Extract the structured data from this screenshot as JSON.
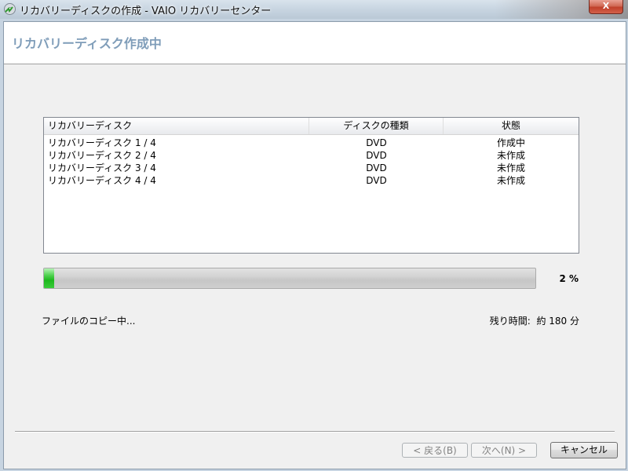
{
  "window": {
    "title": "リカバリーディスクの作成 - VAIO リカバリーセンター",
    "close_label": "X"
  },
  "header": {
    "title": "リカバリーディスク作成中"
  },
  "list": {
    "columns": [
      "リカバリーディスク",
      "ディスクの種類",
      "状態"
    ],
    "rows": [
      [
        "リカバリーディスク 1 / 4",
        "DVD",
        "作成中"
      ],
      [
        "リカバリーディスク 2 / 4",
        "DVD",
        "未作成"
      ],
      [
        "リカバリーディスク 3 / 4",
        "DVD",
        "未作成"
      ],
      [
        "リカバリーディスク 4 / 4",
        "DVD",
        "未作成"
      ]
    ]
  },
  "progress": {
    "value": 0.02,
    "percent_label": "2 %"
  },
  "status": {
    "message": "ファイルのコピー中...",
    "remaining_label": "残り時間:",
    "remaining_value": "約 180 分"
  },
  "buttons": {
    "back": "< 戻る(B)",
    "next": "次へ(N) >",
    "cancel": "キャンセル"
  },
  "colors": {
    "header_title": "#7f9db9",
    "progress_fill": "#1eb81e"
  }
}
